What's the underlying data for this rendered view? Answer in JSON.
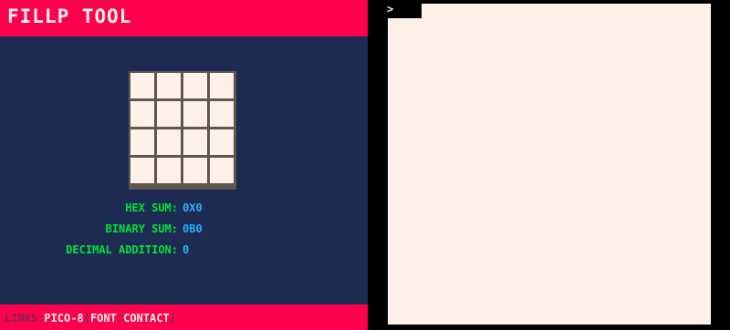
{
  "app": {
    "title": "FILLP TOOL"
  },
  "pattern_grid": {
    "rows": 4,
    "cols": 4,
    "cells": [
      [
        false,
        false,
        false,
        false
      ],
      [
        false,
        false,
        false,
        false
      ],
      [
        false,
        false,
        false,
        false
      ],
      [
        false,
        false,
        false,
        false
      ]
    ],
    "off_color": "#fff1e8",
    "border_color": "#5f574f"
  },
  "info": {
    "hex_label": "HEX SUM:",
    "hex_value": "0X0",
    "binary_label": "BINARY SUM:",
    "binary_value": "0B0",
    "decimal_label": "DECIMAL ADDITION:",
    "decimal_value": "0"
  },
  "footer": {
    "label": "LINKS:",
    "links": [
      {
        "label": "PICO-8"
      },
      {
        "label": "FONT"
      },
      {
        "label": "CONTACT"
      }
    ],
    "separator": "|"
  },
  "console": {
    "prompt": ">"
  },
  "colors": {
    "panel_bg": "#1d2b53",
    "accent": "#ff004d",
    "label_green": "#00e436",
    "value_blue": "#29adff",
    "cream": "#fff1e8",
    "footer_label": "#7e2553"
  }
}
